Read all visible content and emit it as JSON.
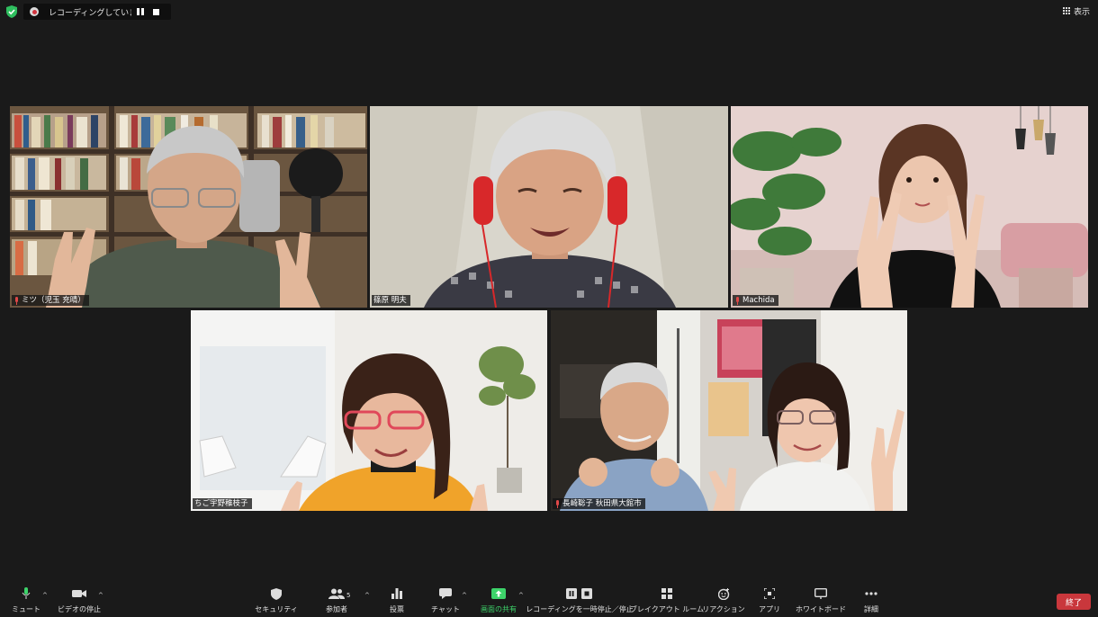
{
  "top_bar": {
    "recording_text": "レコーディングしています...",
    "view_label": "表示"
  },
  "participants": [
    {
      "name": "ミツ（児玉 充晴）",
      "muted": true,
      "active": false
    },
    {
      "name": "篠原 明夫",
      "muted": false,
      "active": true
    },
    {
      "name": "Machida",
      "muted": true,
      "active": false
    },
    {
      "name": "ちご宇野稚枝子",
      "muted": false,
      "active": false
    },
    {
      "name": "長崎聡子 秋田県大館市",
      "muted": true,
      "active": false
    }
  ],
  "toolbar": {
    "mute_label": "ミュート",
    "video_label": "ビデオの停止",
    "security_label": "セキュリティ",
    "participants_label": "参加者",
    "participants_count": "5",
    "polls_label": "投票",
    "chat_label": "チャット",
    "share_label": "画面の共有",
    "recording_label": "レコーディングを一時停止／停止",
    "breakout_label": "ブレイクアウト ルーム",
    "reactions_label": "リアクション",
    "apps_label": "アプリ",
    "whiteboard_label": "ホワイトボード",
    "more_label": "詳細",
    "end_label": "終了"
  },
  "colors": {
    "background": "#1a1a1a",
    "active_speaker": "#c9e85a",
    "end_button": "#c9373c",
    "share_green": "#3dd36a",
    "muted_red": "#e04848"
  }
}
